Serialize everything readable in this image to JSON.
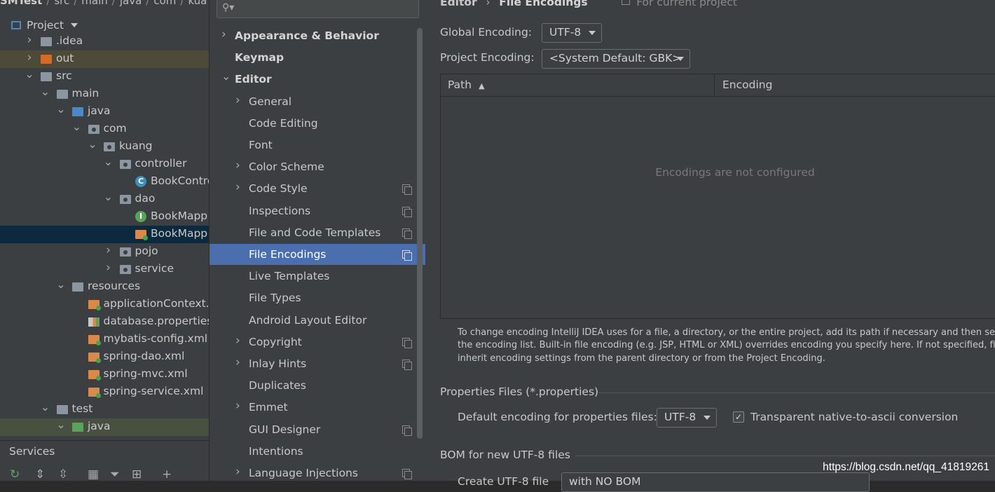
{
  "project_panel": {
    "breadcrumb": [
      "SMTest",
      "src",
      "main",
      "java",
      "com",
      "kua"
    ],
    "header": "Project",
    "tree": [
      {
        "label": ".idea",
        "depth": 1,
        "arrow": "right",
        "icon": "folder"
      },
      {
        "label": "out",
        "depth": 1,
        "arrow": "right",
        "icon": "folder-orange"
      },
      {
        "label": "src",
        "depth": 1,
        "arrow": "down",
        "icon": "folder"
      },
      {
        "label": "main",
        "depth": 2,
        "arrow": "down",
        "icon": "folder"
      },
      {
        "label": "java",
        "depth": 3,
        "arrow": "down",
        "icon": "folder-blue"
      },
      {
        "label": "com",
        "depth": 4,
        "arrow": "down",
        "icon": "package"
      },
      {
        "label": "kuang",
        "depth": 5,
        "arrow": "down",
        "icon": "package"
      },
      {
        "label": "controller",
        "depth": 6,
        "arrow": "down",
        "icon": "package"
      },
      {
        "label": "BookContro",
        "depth": 7,
        "arrow": "",
        "icon": "class-icon"
      },
      {
        "label": "dao",
        "depth": 6,
        "arrow": "down",
        "icon": "package"
      },
      {
        "label": "BookMapp",
        "depth": 7,
        "arrow": "",
        "icon": "interface-icon"
      },
      {
        "label": "BookMapp",
        "depth": 7,
        "arrow": "",
        "icon": "xml-icon"
      },
      {
        "label": "pojo",
        "depth": 6,
        "arrow": "right",
        "icon": "package"
      },
      {
        "label": "service",
        "depth": 6,
        "arrow": "right",
        "icon": "package"
      },
      {
        "label": "resources",
        "depth": 3,
        "arrow": "down",
        "icon": "folder-resources"
      },
      {
        "label": "applicationContext.x",
        "depth": 4,
        "arrow": "",
        "icon": "xml-icon"
      },
      {
        "label": "database.properties",
        "depth": 4,
        "arrow": "",
        "icon": "properties-icon"
      },
      {
        "label": "mybatis-config.xml",
        "depth": 4,
        "arrow": "",
        "icon": "xml-icon"
      },
      {
        "label": "spring-dao.xml",
        "depth": 4,
        "arrow": "",
        "icon": "xml-icon"
      },
      {
        "label": "spring-mvc.xml",
        "depth": 4,
        "arrow": "",
        "icon": "xml-icon"
      },
      {
        "label": "spring-service.xml",
        "depth": 4,
        "arrow": "",
        "icon": "xml-icon"
      },
      {
        "label": "test",
        "depth": 2,
        "arrow": "down",
        "icon": "folder"
      },
      {
        "label": "java",
        "depth": 3,
        "arrow": "down",
        "icon": "folder-green"
      }
    ],
    "services_label": "Services"
  },
  "settings_tree": {
    "search_placeholder": "",
    "items": [
      {
        "label": "Appearance & Behavior",
        "level": 0,
        "arrow": "right",
        "bold": true,
        "copy": false
      },
      {
        "label": "Keymap",
        "level": 0,
        "arrow": "",
        "bold": true,
        "copy": false
      },
      {
        "label": "Editor",
        "level": 0,
        "arrow": "down",
        "bold": true,
        "copy": false
      },
      {
        "label": "General",
        "level": 1,
        "arrow": "right",
        "bold": false,
        "copy": false
      },
      {
        "label": "Code Editing",
        "level": 1,
        "arrow": "",
        "bold": false,
        "copy": false
      },
      {
        "label": "Font",
        "level": 1,
        "arrow": "",
        "bold": false,
        "copy": false
      },
      {
        "label": "Color Scheme",
        "level": 1,
        "arrow": "right",
        "bold": false,
        "copy": false
      },
      {
        "label": "Code Style",
        "level": 1,
        "arrow": "right",
        "bold": false,
        "copy": true
      },
      {
        "label": "Inspections",
        "level": 1,
        "arrow": "",
        "bold": false,
        "copy": true
      },
      {
        "label": "File and Code Templates",
        "level": 1,
        "arrow": "",
        "bold": false,
        "copy": true
      },
      {
        "label": "File Encodings",
        "level": 1,
        "arrow": "",
        "bold": false,
        "copy": true,
        "selected": true
      },
      {
        "label": "Live Templates",
        "level": 1,
        "arrow": "",
        "bold": false,
        "copy": false
      },
      {
        "label": "File Types",
        "level": 1,
        "arrow": "",
        "bold": false,
        "copy": false
      },
      {
        "label": "Android Layout Editor",
        "level": 1,
        "arrow": "",
        "bold": false,
        "copy": false
      },
      {
        "label": "Copyright",
        "level": 1,
        "arrow": "right",
        "bold": false,
        "copy": true
      },
      {
        "label": "Inlay Hints",
        "level": 1,
        "arrow": "right",
        "bold": false,
        "copy": true
      },
      {
        "label": "Duplicates",
        "level": 1,
        "arrow": "",
        "bold": false,
        "copy": false
      },
      {
        "label": "Emmet",
        "level": 1,
        "arrow": "right",
        "bold": false,
        "copy": false
      },
      {
        "label": "GUI Designer",
        "level": 1,
        "arrow": "",
        "bold": false,
        "copy": true
      },
      {
        "label": "Intentions",
        "level": 1,
        "arrow": "",
        "bold": false,
        "copy": false
      },
      {
        "label": "Language Injections",
        "level": 1,
        "arrow": "right",
        "bold": false,
        "copy": true
      }
    ]
  },
  "content": {
    "breadcrumb_parent": "Editor",
    "breadcrumb_current": "File Encodings",
    "scope_note": "For current project",
    "global_encoding_label": "Global Encoding:",
    "global_encoding_value": "UTF-8",
    "project_encoding_label": "Project Encoding:",
    "project_encoding_value": "<System Default: GBK>",
    "table": {
      "col_path": "Path",
      "col_encoding": "Encoding",
      "empty_text": "Encodings are not configured"
    },
    "hint_lines": [
      "To change encoding IntelliJ IDEA uses for a file, a directory, or the entire project, add its path if necessary and then select enc",
      "the encoding list. Built-in file encoding (e.g. JSP, HTML or XML) overrides encoding you specify here. If not specified, files and",
      "inherit encoding settings from the parent directory or from the Project Encoding."
    ],
    "properties_section": "Properties Files (*.properties)",
    "default_encoding_label": "Default encoding for properties files:",
    "default_encoding_value": "UTF-8",
    "transparent_label": "Transparent native-to-ascii conversion",
    "transparent_checked": true,
    "bom_section": "BOM for new UTF-8 files",
    "bom_partial_label": "Create UTF-8 file",
    "bom_partial_value": "with NO BOM"
  },
  "watermark": "https://blog.csdn.net/qq_41819261"
}
